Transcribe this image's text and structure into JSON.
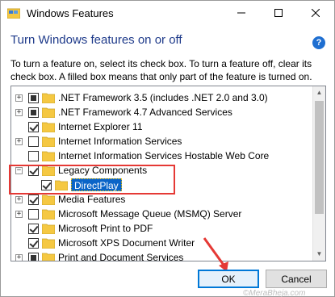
{
  "window": {
    "title": "Windows Features",
    "minimize_icon": "minimize-icon",
    "maximize_icon": "maximize-icon",
    "close_icon": "close-icon"
  },
  "heading": "Turn Windows features on or off",
  "help_icon_label": "?",
  "description": "To turn a feature on, select its check box. To turn a feature off, clear its check box. A filled box means that only part of the feature is turned on.",
  "features": [
    {
      "label": ".NET Framework 3.5 (includes .NET 2.0 and 3.0)",
      "expander": "+",
      "state": "partial",
      "level": 0
    },
    {
      "label": ".NET Framework 4.7 Advanced Services",
      "expander": "+",
      "state": "partial",
      "level": 0
    },
    {
      "label": "Internet Explorer 11",
      "expander": "",
      "state": "checked",
      "level": 0
    },
    {
      "label": "Internet Information Services",
      "expander": "+",
      "state": "unchecked",
      "level": 0
    },
    {
      "label": "Internet Information Services Hostable Web Core",
      "expander": "",
      "state": "unchecked",
      "level": 0
    },
    {
      "label": "Legacy Components",
      "expander": "−",
      "state": "checked",
      "level": 0
    },
    {
      "label": "DirectPlay",
      "expander": "",
      "state": "checked",
      "level": 1,
      "selected": true
    },
    {
      "label": "Media Features",
      "expander": "+",
      "state": "checked",
      "level": 0
    },
    {
      "label": "Microsoft Message Queue (MSMQ) Server",
      "expander": "+",
      "state": "unchecked",
      "level": 0
    },
    {
      "label": "Microsoft Print to PDF",
      "expander": "",
      "state": "checked",
      "level": 0
    },
    {
      "label": "Microsoft XPS Document Writer",
      "expander": "",
      "state": "checked",
      "level": 0
    },
    {
      "label": "Print and Document Services",
      "expander": "+",
      "state": "partial",
      "level": 0
    }
  ],
  "buttons": {
    "ok": "OK",
    "cancel": "Cancel"
  },
  "watermark": "©MeraBheja.com",
  "colors": {
    "accent": "#0078d7",
    "heading": "#1e3a8a",
    "highlight": "#e53935",
    "selection": "#0a64c8",
    "folder": "#f5c842"
  }
}
